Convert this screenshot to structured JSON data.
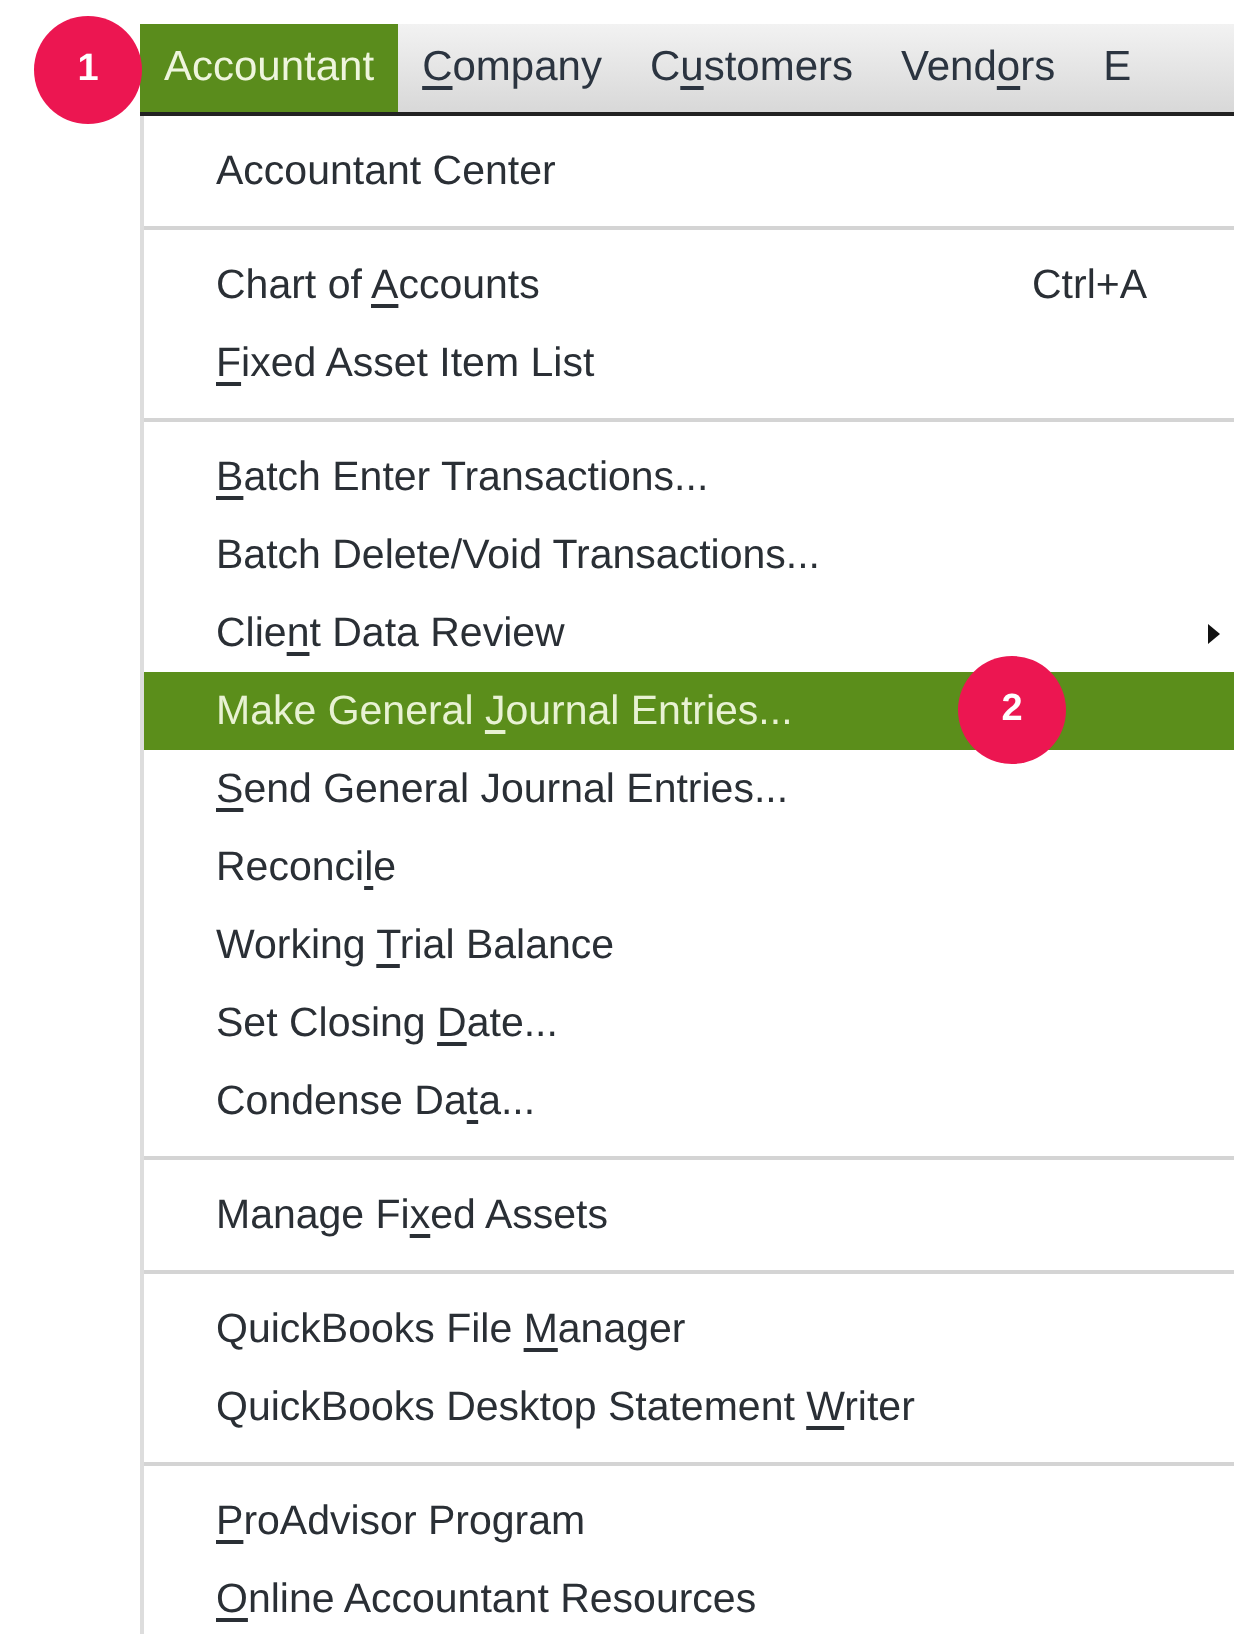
{
  "menubar": [
    {
      "label": [
        {
          "text": "Accountant",
          "underlined": false
        }
      ],
      "selected": true,
      "callout": "1"
    },
    {
      "label": [
        {
          "text": "C",
          "underlined": true
        },
        {
          "text": "ompany",
          "underlined": false
        }
      ],
      "selected": false
    },
    {
      "label": [
        {
          "text": "C",
          "underlined": false
        },
        {
          "text": "u",
          "underlined": true
        },
        {
          "text": "stomers",
          "underlined": false
        }
      ],
      "selected": false
    },
    {
      "label": [
        {
          "text": "Vend",
          "underlined": false
        },
        {
          "text": "o",
          "underlined": true
        },
        {
          "text": "rs",
          "underlined": false
        }
      ],
      "selected": false
    },
    {
      "label": [
        {
          "text": "E",
          "underlined": false
        }
      ],
      "selected": false
    }
  ],
  "menu": [
    {
      "kind": "item",
      "label": [
        {
          "text": "Accountant Center",
          "underlined": false
        }
      ],
      "selected": false,
      "submenu": false
    },
    {
      "kind": "separator"
    },
    {
      "kind": "item",
      "label": [
        {
          "text": "Chart of ",
          "underlined": false
        },
        {
          "text": "A",
          "underlined": true
        },
        {
          "text": "ccounts",
          "underlined": false
        }
      ],
      "shortcut": "Ctrl+A",
      "selected": false,
      "submenu": false
    },
    {
      "kind": "item",
      "label": [
        {
          "text": "F",
          "underlined": true
        },
        {
          "text": "ixed Asset Item List",
          "underlined": false
        }
      ],
      "selected": false,
      "submenu": false
    },
    {
      "kind": "separator"
    },
    {
      "kind": "item",
      "label": [
        {
          "text": "B",
          "underlined": true
        },
        {
          "text": "atch Enter Transactions...",
          "underlined": false
        }
      ],
      "selected": false,
      "submenu": false
    },
    {
      "kind": "item",
      "label": [
        {
          "text": "Batch Delete/Void Transactions...",
          "underlined": false
        }
      ],
      "selected": false,
      "submenu": false
    },
    {
      "kind": "item",
      "label": [
        {
          "text": "Clie",
          "underlined": false
        },
        {
          "text": "n",
          "underlined": true
        },
        {
          "text": "t Data Review",
          "underlined": false
        }
      ],
      "selected": false,
      "submenu": true
    },
    {
      "kind": "item",
      "label": [
        {
          "text": "Make General ",
          "underlined": false
        },
        {
          "text": "J",
          "underlined": true
        },
        {
          "text": "ournal Entries...",
          "underlined": false
        }
      ],
      "selected": true,
      "submenu": false,
      "callout": "2"
    },
    {
      "kind": "item",
      "label": [
        {
          "text": "S",
          "underlined": true
        },
        {
          "text": "end General Journal Entries...",
          "underlined": false
        }
      ],
      "selected": false,
      "submenu": false
    },
    {
      "kind": "item",
      "label": [
        {
          "text": "Reconci",
          "underlined": false
        },
        {
          "text": "l",
          "underlined": true
        },
        {
          "text": "e",
          "underlined": false
        }
      ],
      "selected": false,
      "submenu": false
    },
    {
      "kind": "item",
      "label": [
        {
          "text": "Working ",
          "underlined": false
        },
        {
          "text": "T",
          "underlined": true
        },
        {
          "text": "rial Balance",
          "underlined": false
        }
      ],
      "selected": false,
      "submenu": false
    },
    {
      "kind": "item",
      "label": [
        {
          "text": "Set Closing ",
          "underlined": false
        },
        {
          "text": "D",
          "underlined": true
        },
        {
          "text": "ate...",
          "underlined": false
        }
      ],
      "selected": false,
      "submenu": false
    },
    {
      "kind": "item",
      "label": [
        {
          "text": "Condense Da",
          "underlined": false
        },
        {
          "text": "t",
          "underlined": true
        },
        {
          "text": "a...",
          "underlined": false
        }
      ],
      "selected": false,
      "submenu": false
    },
    {
      "kind": "separator"
    },
    {
      "kind": "item",
      "label": [
        {
          "text": "Manage Fi",
          "underlined": false
        },
        {
          "text": "x",
          "underlined": true
        },
        {
          "text": "ed Assets",
          "underlined": false
        }
      ],
      "selected": false,
      "submenu": false
    },
    {
      "kind": "separator"
    },
    {
      "kind": "item",
      "label": [
        {
          "text": "QuickBooks File ",
          "underlined": false
        },
        {
          "text": "M",
          "underlined": true
        },
        {
          "text": "anager",
          "underlined": false
        }
      ],
      "selected": false,
      "submenu": false
    },
    {
      "kind": "item",
      "label": [
        {
          "text": "QuickBooks Desktop Statement ",
          "underlined": false
        },
        {
          "text": "W",
          "underlined": true
        },
        {
          "text": "riter",
          "underlined": false
        }
      ],
      "selected": false,
      "submenu": false
    },
    {
      "kind": "separator"
    },
    {
      "kind": "item",
      "label": [
        {
          "text": "P",
          "underlined": true
        },
        {
          "text": "roAdvisor Program",
          "underlined": false
        }
      ],
      "selected": false,
      "submenu": false
    },
    {
      "kind": "item",
      "label": [
        {
          "text": "O",
          "underlined": true
        },
        {
          "text": "nline Accountant Resources",
          "underlined": false
        }
      ],
      "selected": false,
      "submenu": false
    }
  ]
}
